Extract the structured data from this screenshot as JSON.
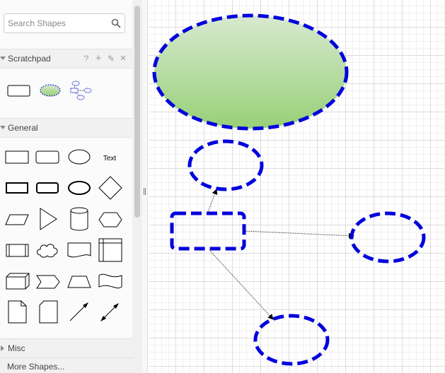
{
  "sidebar": {
    "search": {
      "placeholder": "Search Shapes",
      "value": "",
      "icon": "search-icon"
    },
    "scratchpad": {
      "title": "Scratchpad",
      "tools": [
        {
          "name": "help",
          "label": "?"
        },
        {
          "name": "add",
          "label": "+"
        },
        {
          "name": "edit",
          "label": "✎"
        },
        {
          "name": "close",
          "label": "×"
        }
      ],
      "items": [
        "rectangle",
        "green-ellipse",
        "connector-group"
      ]
    },
    "general": {
      "title": "General",
      "shapes": [
        "rectangle",
        "rounded-rectangle",
        "ellipse",
        "text",
        "thick-rectangle",
        "thick-rounded-rectangle",
        "thick-ellipse",
        "diamond",
        "parallelogram",
        "triangle",
        "cylinder",
        "hexagon",
        "process",
        "cloud",
        "document",
        "internal-storage",
        "cube",
        "step",
        "trapezoid",
        "tape",
        "note",
        "card",
        "line-arrow",
        "bidirectional-arrow"
      ],
      "text_label": "Text"
    },
    "misc": {
      "title": "Misc"
    },
    "more_shapes": "More Shapes..."
  },
  "colors": {
    "selection_blue": "#0000dd",
    "ellipse_fill_top": "#d8e9d0",
    "ellipse_fill_bottom": "#97d077",
    "grid": "#dcdcdc"
  },
  "canvas": {
    "shapes": [
      {
        "id": "big-ellipse",
        "type": "ellipse",
        "fill": "gradient-green",
        "border": "dashed-blue"
      },
      {
        "id": "ellipse-top",
        "type": "ellipse",
        "border": "dashed-blue"
      },
      {
        "id": "source-rect",
        "type": "rounded-rectangle",
        "border": "dashed-blue"
      },
      {
        "id": "ellipse-right",
        "type": "ellipse",
        "border": "dashed-blue"
      },
      {
        "id": "ellipse-bottom",
        "type": "ellipse",
        "border": "dashed-blue"
      }
    ],
    "connectors": [
      {
        "from": "source-rect",
        "to": "ellipse-top",
        "style": "dotted"
      },
      {
        "from": "source-rect",
        "to": "ellipse-right",
        "style": "dotted"
      },
      {
        "from": "source-rect",
        "to": "ellipse-bottom",
        "style": "dotted"
      }
    ]
  }
}
